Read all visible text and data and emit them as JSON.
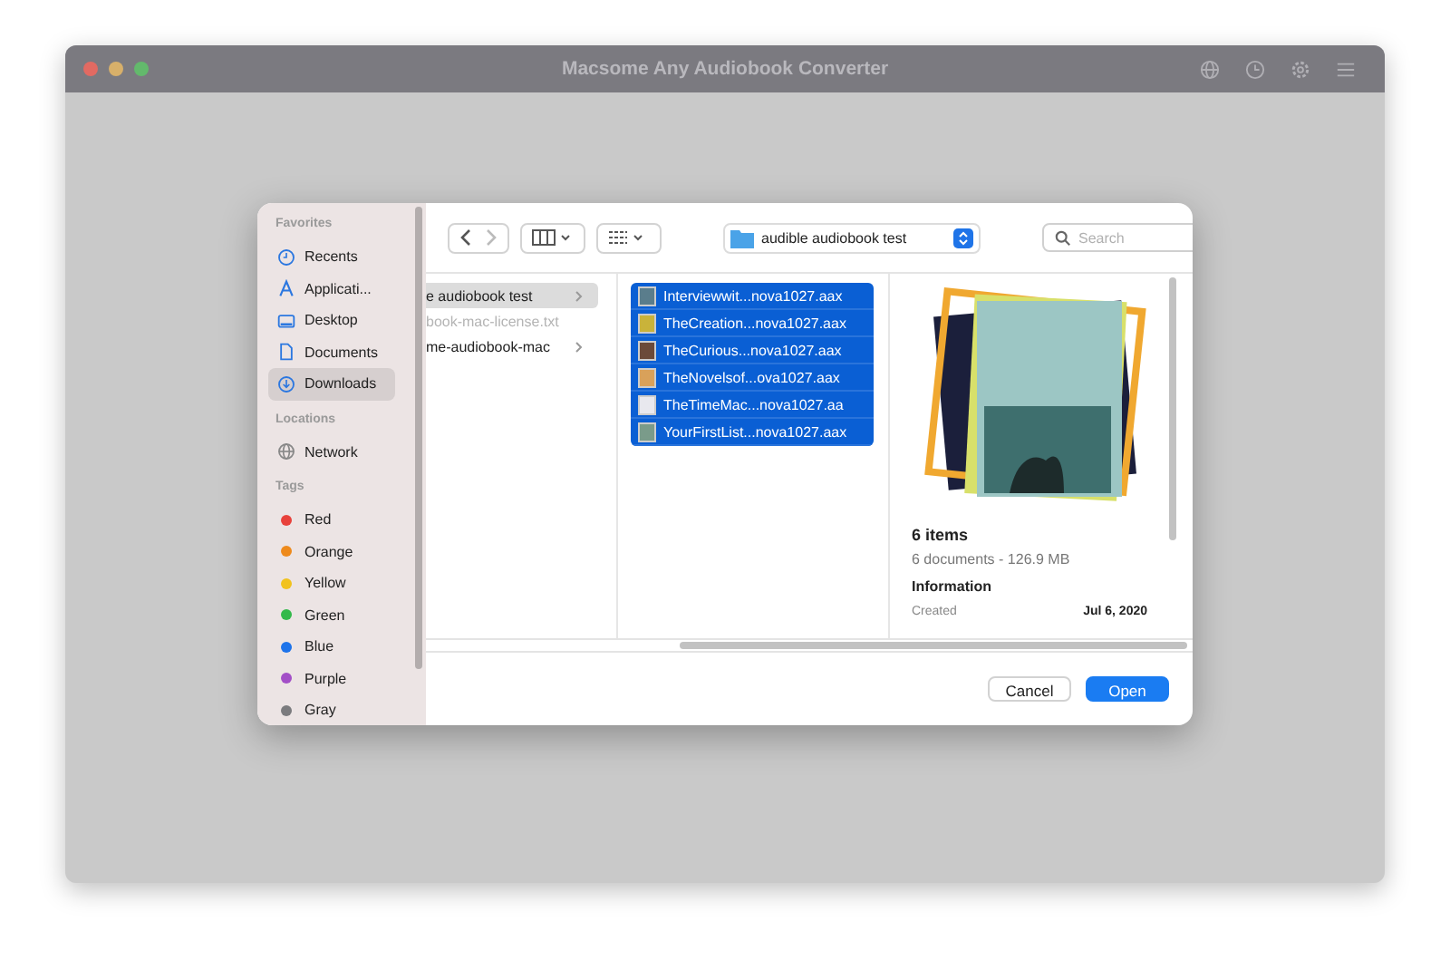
{
  "window": {
    "title": "Macsome Any Audiobook Converter"
  },
  "sidebar": {
    "sections": [
      {
        "heading": "Favorites",
        "items": [
          {
            "label": "Recents",
            "selected": false
          },
          {
            "label": "Applicati...",
            "selected": false
          },
          {
            "label": "Desktop",
            "selected": false
          },
          {
            "label": "Documents",
            "selected": false
          },
          {
            "label": "Downloads",
            "selected": true
          }
        ]
      },
      {
        "heading": "Locations",
        "items": [
          {
            "label": "Network",
            "selected": false
          }
        ]
      }
    ],
    "tags_heading": "Tags",
    "tags": [
      {
        "label": "Red",
        "color": "#e8413b"
      },
      {
        "label": "Orange",
        "color": "#ee8a1c"
      },
      {
        "label": "Yellow",
        "color": "#f1c21d"
      },
      {
        "label": "Green",
        "color": "#33b94b"
      },
      {
        "label": "Blue",
        "color": "#1d73ea"
      },
      {
        "label": "Purple",
        "color": "#a34fc7"
      },
      {
        "label": "Gray",
        "color": "#7b7b7e"
      }
    ]
  },
  "toolbar": {
    "location": "audible audiobook test",
    "search": {
      "placeholder": "Search"
    }
  },
  "column_1": [
    {
      "name": "e audiobook test",
      "selected": true,
      "disabled": false,
      "folder": true
    },
    {
      "name": "book-mac-license.txt",
      "selected": false,
      "disabled": true,
      "folder": false
    },
    {
      "name": "me-audiobook-mac",
      "selected": false,
      "disabled": false,
      "folder": true
    }
  ],
  "files": [
    {
      "name": "Interviewwit...nova1027.aax",
      "selected": true,
      "color": "#5a7d8c"
    },
    {
      "name": "TheCreation...nova1027.aax",
      "selected": true,
      "color": "#c9b33a"
    },
    {
      "name": "TheCurious...nova1027.aax",
      "selected": true,
      "color": "#6b4a3a"
    },
    {
      "name": "TheNovelsof...ova1027.aax",
      "selected": true,
      "color": "#d9a15a"
    },
    {
      "name": "TheTimeMac...nova1027.aa",
      "selected": true,
      "color": "#e8e8ee"
    },
    {
      "name": "YourFirstList...nova1027.aax",
      "selected": true,
      "color": "#7a9b8a"
    }
  ],
  "preview": {
    "count": "6 items",
    "summary": "6 documents - 126.9 MB",
    "info_heading": "Information",
    "created_label": "Created",
    "created_value": "Jul 6, 2020"
  },
  "buttons": [
    {
      "label": "Cancel",
      "kind": "secondary"
    },
    {
      "label": "Open",
      "kind": "primary"
    }
  ]
}
